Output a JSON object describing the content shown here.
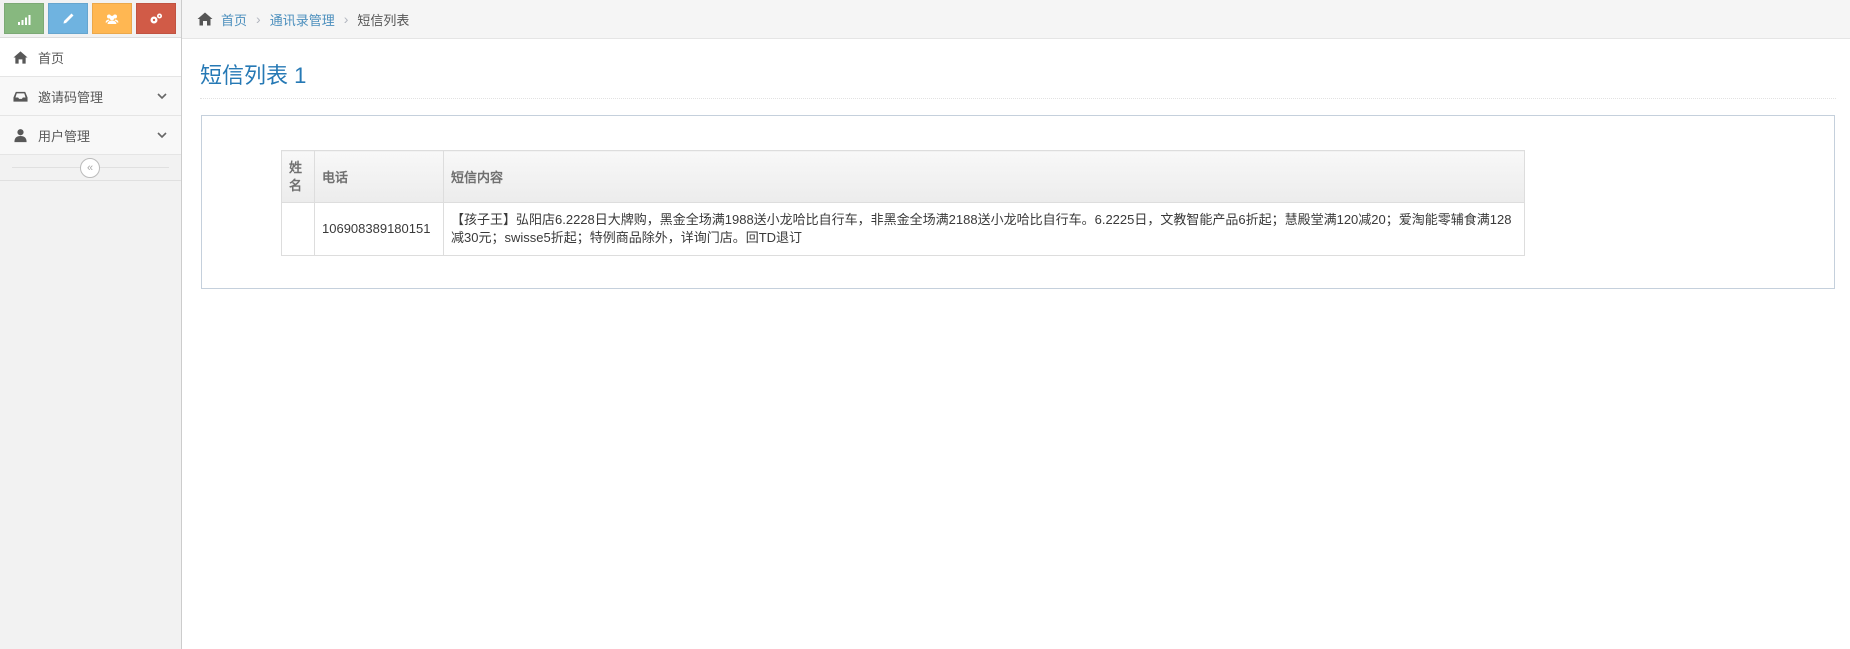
{
  "sidebar": {
    "shortcuts": [
      {
        "icon": "signal-icon",
        "color": "#87b87f"
      },
      {
        "icon": "pencil-icon",
        "color": "#6fb3e0"
      },
      {
        "icon": "users-icon",
        "color": "#ffb752"
      },
      {
        "icon": "cogs-icon",
        "color": "#d15b47"
      }
    ],
    "items": [
      {
        "label": "首页",
        "icon": "home-icon"
      },
      {
        "label": "邀请码管理",
        "icon": "inbox-icon"
      },
      {
        "label": "用户管理",
        "icon": "user-icon"
      }
    ],
    "collapse_glyph": "«"
  },
  "breadcrumb": {
    "home": "首页",
    "section": "通讯录管理",
    "current": "短信列表",
    "separator": "›"
  },
  "page": {
    "title": "短信列表 1"
  },
  "table": {
    "headers": {
      "name": "姓名",
      "phone": "电话",
      "content": "短信内容"
    },
    "rows": [
      {
        "name": "",
        "phone": "106908389180151",
        "content": "【孩子王】弘阳店6.2228日大牌购，黑金全场满1988送小龙哈比自行车，非黑金全场满2188送小龙哈比自行车。6.2225日，文教智能产品6折起；慧殿堂满120减20；爱淘能零辅食满128减30元；swisse5折起；特例商品除外，详询门店。回TD退订"
      }
    ]
  }
}
